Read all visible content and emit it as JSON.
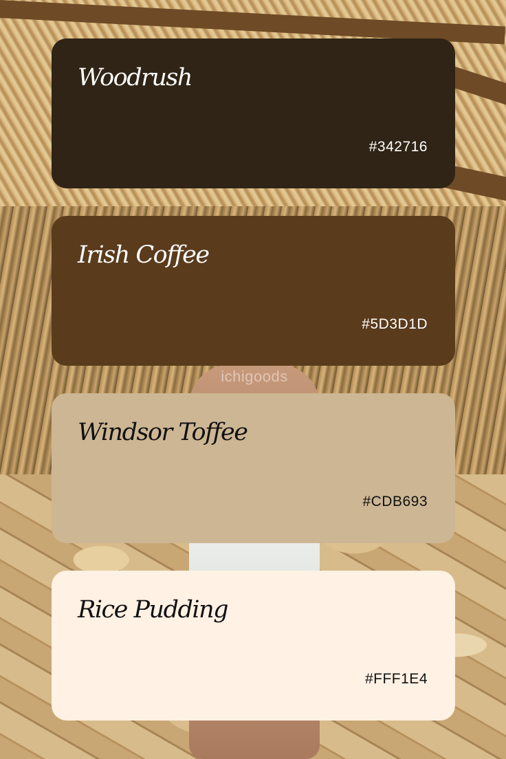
{
  "watermark": "ichigoods",
  "swatches": [
    {
      "name": "Woodrush",
      "hex": "#342716",
      "color": "#2f2416",
      "text_color": "#ffffff"
    },
    {
      "name": "Irish Coffee",
      "hex": "#5D3D1D",
      "color": "#5a3b1c",
      "text_color": "#ffffff"
    },
    {
      "name": "Windsor Toffee",
      "hex": "#CDB693",
      "color": "#cdb693",
      "text_color": "#111111"
    },
    {
      "name": "Rice Pudding",
      "hex": "#FFF1E4",
      "color": "#fff1e4",
      "text_color": "#111111"
    }
  ]
}
